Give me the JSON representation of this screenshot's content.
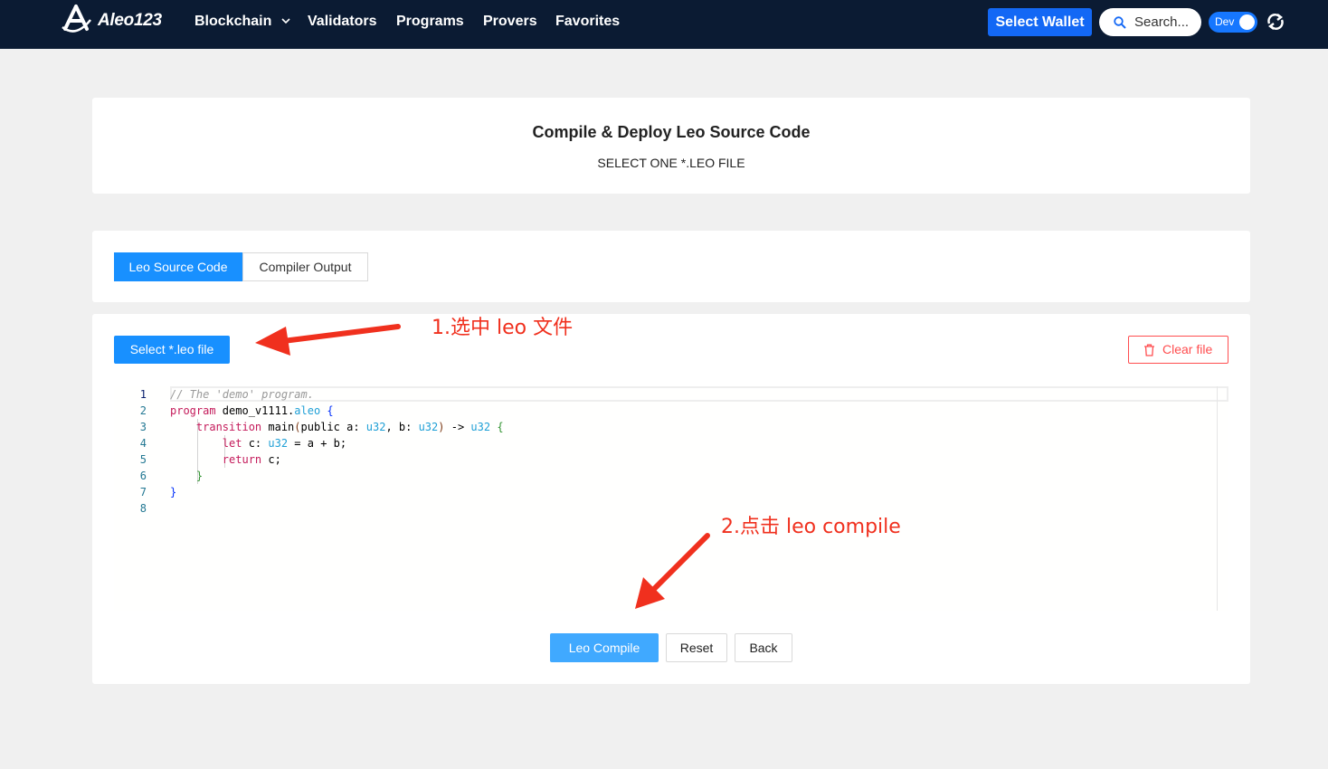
{
  "brand": {
    "name": "Aleo123",
    "logo_icon": "aleo-logo-icon"
  },
  "nav": {
    "items": [
      {
        "label": "Blockchain",
        "has_dropdown": true
      },
      {
        "label": "Validators"
      },
      {
        "label": "Programs"
      },
      {
        "label": "Provers"
      },
      {
        "label": "Favorites"
      }
    ],
    "wallet_button": "Select Wallet",
    "search_placeholder": "Search...",
    "env_toggle": {
      "label": "Dev",
      "on": true
    },
    "refresh_icon": "refresh-icon"
  },
  "header_card": {
    "title": "Compile & Deploy Leo Source Code",
    "subtitle": "SELECT ONE *.LEO FILE"
  },
  "tabs": {
    "items": [
      "Leo Source Code",
      "Compiler Output"
    ],
    "active": "Leo Source Code"
  },
  "editor_card": {
    "select_button": "Select *.leo file",
    "clear_button": "Clear file",
    "line_numbers": [
      "1",
      "2",
      "3",
      "4",
      "5",
      "6",
      "7",
      "8"
    ],
    "code_lines": [
      "// The 'demo' program.",
      "program demo_v1111.aleo {",
      "    transition main(public a: u32, b: u32) -> u32 {",
      "        let c: u32 = a + b;",
      "        return c;",
      "    }",
      "}",
      ""
    ],
    "compile_button": "Leo Compile",
    "reset_button": "Reset",
    "back_button": "Back"
  },
  "annotations": {
    "step1": "1.选中 leo 文件",
    "step2": "2.点击 leo compile",
    "color": "#f0301e"
  },
  "colors": {
    "navbar": "#0b1b33",
    "primary": "#1890ff",
    "danger": "#ff4d4f",
    "page_bg": "#f0f0f0"
  }
}
